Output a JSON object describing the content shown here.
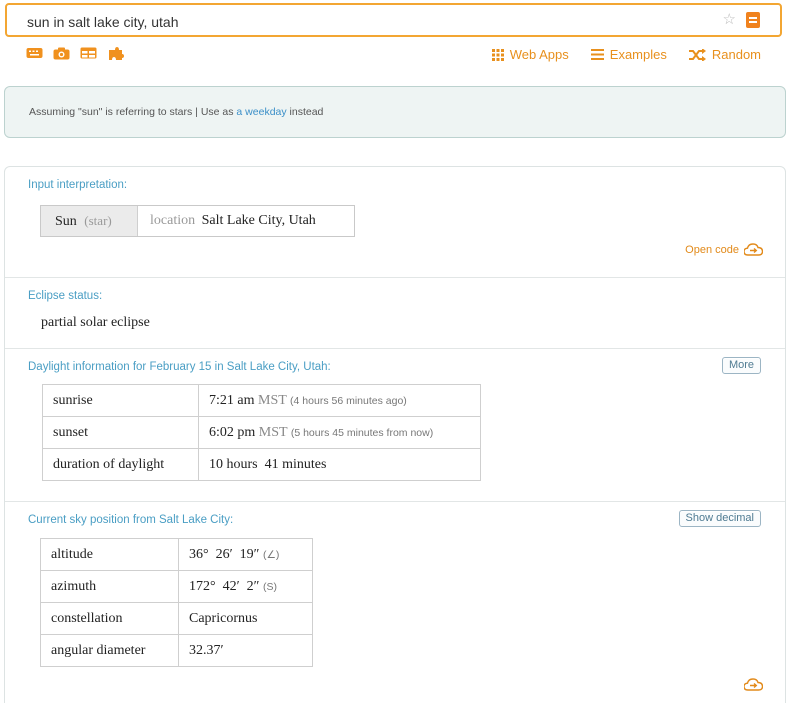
{
  "search": {
    "value": "sun in salt lake city, utah",
    "star_icon": "star-icon",
    "go_icon": "equals-icon"
  },
  "toolbar": {
    "left_icons": [
      "keyboard-icon",
      "camera-icon",
      "table-icon",
      "puzzle-icon"
    ],
    "links": [
      {
        "label": "Web Apps",
        "icon": "grid-icon"
      },
      {
        "label": "Examples",
        "icon": "menu-icon"
      },
      {
        "label": "Random",
        "icon": "shuffle-icon"
      }
    ]
  },
  "assumption": {
    "prefix": "Assuming \"sun\" is referring to stars | Use as ",
    "link": "a weekday",
    "suffix": " instead"
  },
  "pods": {
    "input": {
      "title": "Input interpretation:",
      "name": "Sun",
      "name_type": "(star)",
      "location_label": "location",
      "location_value": "Salt Lake City, Utah",
      "open_code": "Open code"
    },
    "eclipse": {
      "title": "Eclipse status:",
      "value": "partial solar eclipse"
    },
    "daylight": {
      "title": "Daylight information for February 15 in Salt Lake City, Utah:",
      "button": "More",
      "rows": [
        {
          "label": "sunrise",
          "value": "7:21 am",
          "unit": "MST",
          "note": "(4 hours 56 minutes ago)"
        },
        {
          "label": "sunset",
          "value": "6:02 pm",
          "unit": "MST",
          "note": "(5 hours 45 minutes from now)"
        },
        {
          "label": "duration of daylight",
          "value": "10 hours  41 minutes",
          "unit": "",
          "note": ""
        }
      ]
    },
    "sky": {
      "title": "Current sky position from Salt Lake City:",
      "button": "Show decimal",
      "rows": [
        {
          "label": "altitude",
          "value": "36°  26′  19″",
          "note": "(∠)"
        },
        {
          "label": "azimuth",
          "value": "172°  42′  2″",
          "note": "(S)"
        },
        {
          "label": "constellation",
          "value": "Capricornus",
          "note": ""
        },
        {
          "label": "angular diameter",
          "value": "32.37′",
          "note": ""
        }
      ]
    }
  },
  "colors": {
    "accent": "#f3a632",
    "link": "#3b8fc8",
    "pod_title": "#4a9ec4"
  }
}
